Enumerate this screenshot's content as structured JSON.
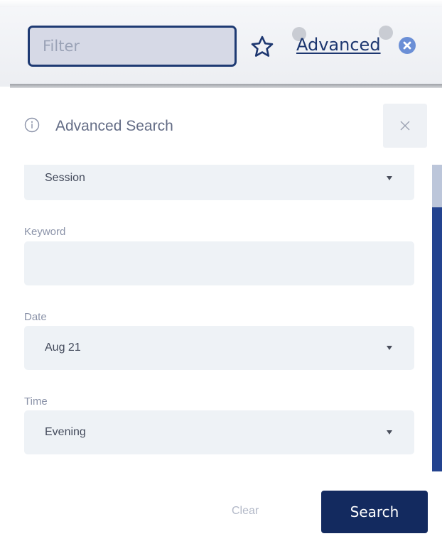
{
  "topbar": {
    "filter_placeholder": "Filter",
    "favorite_icon": "star-outline-icon",
    "advanced_label": "Advanced",
    "clear_icon": "circle-x-icon"
  },
  "panel": {
    "title": "Advanced Search",
    "info_icon": "info-circle-icon",
    "close_icon": "close-x-icon",
    "fields": {
      "type_value": "Session",
      "keyword_label": "Keyword",
      "keyword_value": "",
      "date_label": "Date",
      "date_value": "Aug 21",
      "time_label": "Time",
      "time_value": "Evening"
    },
    "clear_label": "Clear",
    "search_label": "Search"
  },
  "colors": {
    "navy": "#132a5f",
    "accent_border": "#1e3a73",
    "field_bg": "#eef2f6",
    "scrollbar": "#23438f"
  }
}
